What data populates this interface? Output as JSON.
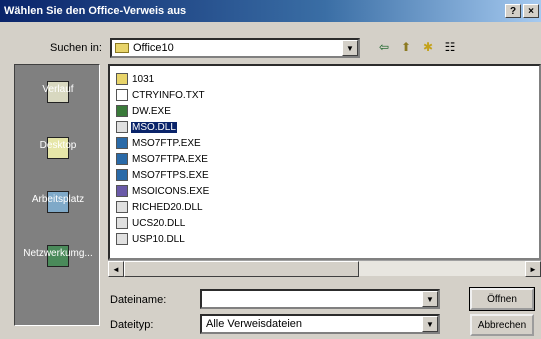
{
  "window": {
    "title": "Wählen Sie den Office-Verweis aus",
    "help_label": "?",
    "close_label": "×"
  },
  "lookin": {
    "label": "Suchen in:",
    "value": "Office10",
    "arrow": "▼"
  },
  "toolbar": {
    "back": "⇦",
    "up": "⬆",
    "newfolder": "✱",
    "views": "☷"
  },
  "places": [
    {
      "label": "Verlauf",
      "color": "#d8d8c0"
    },
    {
      "label": "Desktop",
      "color": "#e6e6a8"
    },
    {
      "label": "Arbeitsplatz",
      "color": "#7fa9c8"
    },
    {
      "label": "Netzwerkumg...",
      "color": "#4a8a5a"
    }
  ],
  "files": [
    {
      "name": "1031",
      "type": "folder"
    },
    {
      "name": "CTRYINFO.TXT",
      "type": "txt"
    },
    {
      "name": "DW.EXE",
      "type": "exe"
    },
    {
      "name": "MSO.DLL",
      "type": "dll",
      "selected": true
    },
    {
      "name": "MSO7FTP.EXE",
      "type": "exe-globe"
    },
    {
      "name": "MSO7FTPA.EXE",
      "type": "exe-globe"
    },
    {
      "name": "MSO7FTPS.EXE",
      "type": "exe-globe"
    },
    {
      "name": "MSOICONS.EXE",
      "type": "exe-icon"
    },
    {
      "name": "RICHED20.DLL",
      "type": "dll"
    },
    {
      "name": "UCS20.DLL",
      "type": "dll"
    },
    {
      "name": "USP10.DLL",
      "type": "dll"
    }
  ],
  "scroll": {
    "left": "◄",
    "right": "►"
  },
  "filename": {
    "label": "Dateiname:",
    "value": "",
    "arrow": "▼"
  },
  "filetype": {
    "label": "Dateityp:",
    "value": "Alle Verweisdateien",
    "arrow": "▼"
  },
  "buttons": {
    "open": "Öffnen",
    "cancel": "Abbrechen"
  }
}
